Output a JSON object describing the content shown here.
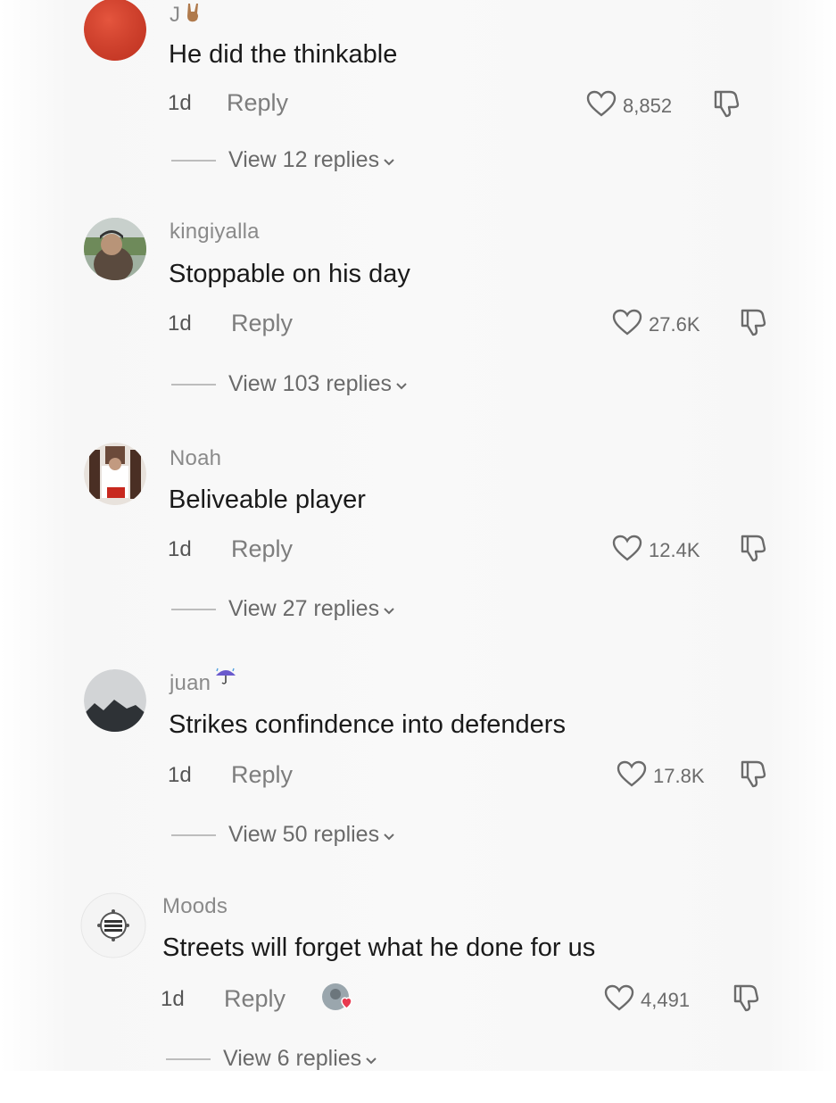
{
  "comments": [
    {
      "username": "J",
      "username_emoji": "rock-hand-emoji",
      "text": "He did the thinkable",
      "time": "1d",
      "reply_label": "Reply",
      "likes": "8,852",
      "view_replies": "View 12 replies"
    },
    {
      "username": "kingiyalla",
      "text": "Stoppable on his day",
      "time": "1d",
      "reply_label": "Reply",
      "likes": "27.6K",
      "view_replies": "View 103 replies"
    },
    {
      "username": "Noah",
      "text": "Beliveable player",
      "time": "1d",
      "reply_label": "Reply",
      "likes": "12.4K",
      "view_replies": "View 27 replies"
    },
    {
      "username": "juan",
      "username_emoji": "umbrella-rain-emoji",
      "text": "Strikes confindence into defenders",
      "time": "1d",
      "reply_label": "Reply",
      "likes": "17.8K",
      "view_replies": "View 50 replies"
    },
    {
      "username": "Moods",
      "text": "Streets will forget what he done for us",
      "time": "1d",
      "reply_label": "Reply",
      "likes": "4,491",
      "liked_by_creator": true,
      "view_replies": "View 6 replies"
    }
  ],
  "icons": {
    "like": "heart-outline-icon",
    "dislike": "thumbs-down-icon",
    "expand": "chevron-down-icon"
  },
  "colors": {
    "text_primary": "#1a1a1a",
    "text_secondary": "#8a8a8a",
    "creator_heart": "#e8394f"
  }
}
